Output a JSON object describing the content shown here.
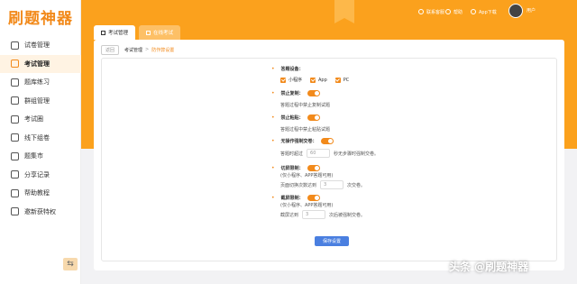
{
  "app": {
    "logo": "刷题神器"
  },
  "sidebar": {
    "items": [
      {
        "label": "试卷管理",
        "icon": "document-icon"
      },
      {
        "label": "考试管理",
        "icon": "pencil-icon",
        "active": true
      },
      {
        "label": "题库练习",
        "icon": "book-icon"
      },
      {
        "label": "群组管理",
        "icon": "group-icon"
      },
      {
        "label": "考试圈",
        "icon": "circle-icon"
      },
      {
        "label": "线下组卷",
        "icon": "file-icon"
      },
      {
        "label": "题集市",
        "icon": "store-icon"
      },
      {
        "label": "分享记录",
        "icon": "share-icon"
      },
      {
        "label": "帮助教程",
        "icon": "help-icon"
      },
      {
        "label": "邀新获特权",
        "icon": "gift-icon"
      }
    ],
    "collapse_icon": "⇆"
  },
  "header": {
    "nav": [
      "联系客服",
      "帮助",
      "App下载"
    ],
    "user": "用户"
  },
  "tabs": [
    {
      "label": "考试管理",
      "active": true
    },
    {
      "label": "在线考试",
      "active": false
    }
  ],
  "breadcrumb": {
    "back": "返回",
    "items": [
      "考试管理",
      "防作弊设置"
    ]
  },
  "form": {
    "devices": {
      "label": "答题设备：",
      "options": [
        "小程序",
        "App",
        "PC"
      ]
    },
    "no_copy": {
      "label": "禁止复制：",
      "desc": "答题过程中禁止复制试题"
    },
    "no_paste": {
      "label": "禁止粘贴：",
      "desc": "答题过程中禁止粘贴试题"
    },
    "idle_submit": {
      "label": "无操作强制交卷：",
      "prefix": "答题时超过",
      "value": "60",
      "suffix": "秒无步骤时强制交卷。"
    },
    "switch_limit": {
      "label": "切屏限制：",
      "note": "(仅小程序、APP答题可用)",
      "prefix": "页面切换次数达到",
      "value": "3",
      "suffix": "次交卷。"
    },
    "screenshot_limit": {
      "label": "截屏限制：",
      "note": "(仅小程序、APP答题可用)",
      "prefix": "截屏达到",
      "value": "3",
      "suffix": "次后被强制交卷。"
    },
    "save_label": "保存设置"
  },
  "watermark": "头条 @刷题神器",
  "colors": {
    "accent": "#f28a1b",
    "header": "#fba11d",
    "button": "#4a7fe0"
  }
}
